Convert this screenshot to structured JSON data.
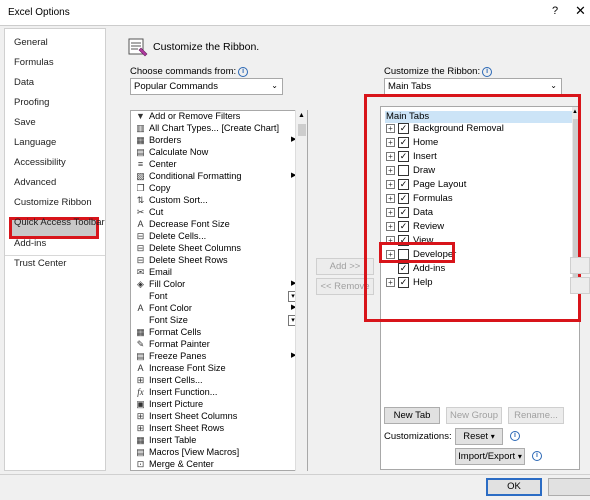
{
  "window": {
    "title": "Excel Options",
    "help": "?",
    "close": "✕"
  },
  "nav": {
    "items": [
      "General",
      "Formulas",
      "Data",
      "Proofing",
      "Save",
      "Language",
      "Accessibility",
      "Advanced",
      "Customize Ribbon",
      "Quick Access Toolbar",
      "Add-ins",
      "Trust Center"
    ],
    "selected": "Customize Ribbon"
  },
  "section": {
    "title": "Customize the Ribbon."
  },
  "left": {
    "label": "Choose commands from:",
    "dropdown_value": "Popular Commands",
    "commands": [
      "Add or Remove Filters",
      "All Chart Types... [Create Chart]",
      "Borders",
      "Calculate Now",
      "Center",
      "Conditional Formatting",
      "Copy",
      "Custom Sort...",
      "Cut",
      "Decrease Font Size",
      "Delete Cells...",
      "Delete Sheet Columns",
      "Delete Sheet Rows",
      "Email",
      "Fill Color",
      "Font",
      "Font Color",
      "Font Size",
      "Format Cells",
      "Format Painter",
      "Freeze Panes",
      "Increase Font Size",
      "Insert Cells...",
      "Insert Function...",
      "Insert Picture",
      "Insert Sheet Columns",
      "Insert Sheet Rows",
      "Insert Table",
      "Macros [View Macros]",
      "Merge & Center"
    ]
  },
  "middle": {
    "add": "Add >>",
    "remove": "<< Remove"
  },
  "right": {
    "label": "Customize the Ribbon:",
    "dropdown_value": "Main Tabs",
    "tree_header": "Main Tabs",
    "tabs": [
      {
        "label": "Background Removal",
        "checked": true
      },
      {
        "label": "Home",
        "checked": true
      },
      {
        "label": "Insert",
        "checked": true
      },
      {
        "label": "Draw",
        "checked": false
      },
      {
        "label": "Page Layout",
        "checked": true
      },
      {
        "label": "Formulas",
        "checked": true
      },
      {
        "label": "Data",
        "checked": true
      },
      {
        "label": "Review",
        "checked": true
      },
      {
        "label": "View",
        "checked": true
      },
      {
        "label": "Developer",
        "checked": false
      },
      {
        "label": "Add-ins",
        "checked": true
      },
      {
        "label": "Help",
        "checked": true
      }
    ],
    "new_tab": "New Tab",
    "new_group": "New Group",
    "rename": "Rename...",
    "customizations_label": "Customizations:",
    "reset": "Reset",
    "import_export": "Import/Export"
  },
  "footer": {
    "ok": "OK"
  },
  "colors": {
    "highlight_red": "#d8141a",
    "selection_blue": "#cce4f7"
  }
}
